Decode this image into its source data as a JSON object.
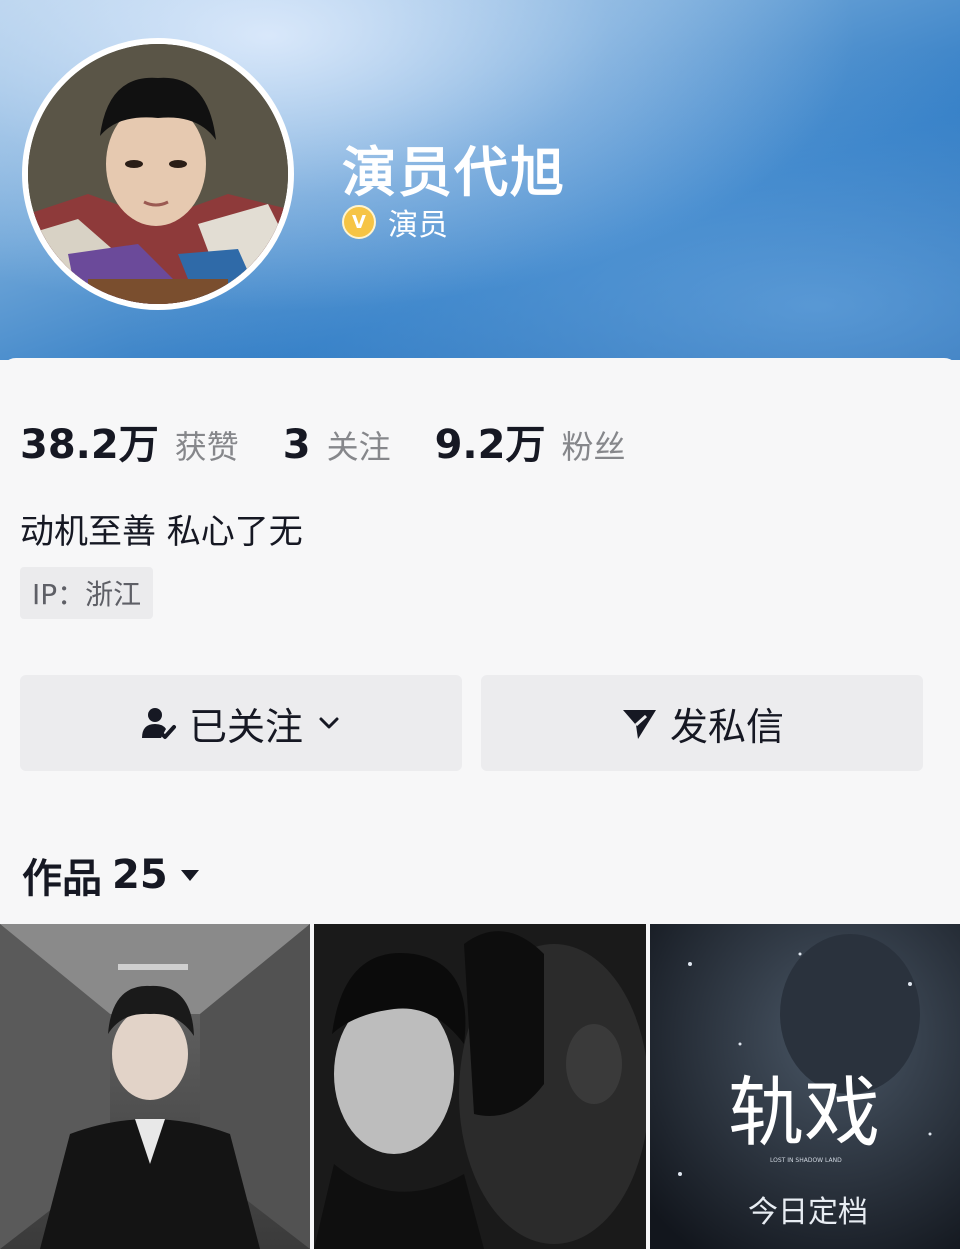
{
  "profile": {
    "name": "演员代旭",
    "verified_label": "演员",
    "verified_icon": "verified-v-icon"
  },
  "stats": [
    {
      "value": "38.2万",
      "label": "获赞"
    },
    {
      "value": "3",
      "label": "关注"
    },
    {
      "value": "9.2万",
      "label": "粉丝"
    }
  ],
  "bio": "动机至善 私心了无",
  "ip_location": "IP：浙江",
  "actions": {
    "follow_label": "已关注",
    "follow_icon": "user-check-icon",
    "message_label": "发私信",
    "message_icon": "send-icon"
  },
  "works": {
    "label": "作品",
    "count": "25"
  },
  "thumbnails": [
    {
      "overlay_text": ""
    },
    {
      "overlay_text": ""
    },
    {
      "overlay_title": "轨戏",
      "overlay_subtitle": "今日定档",
      "overlay_small": "LOST IN SHADOW LAND"
    }
  ],
  "colors": {
    "accent_blue": "#2f7bc4",
    "verified_gold": "#f6c445",
    "text_primary": "#161823",
    "text_secondary": "#86878b"
  }
}
